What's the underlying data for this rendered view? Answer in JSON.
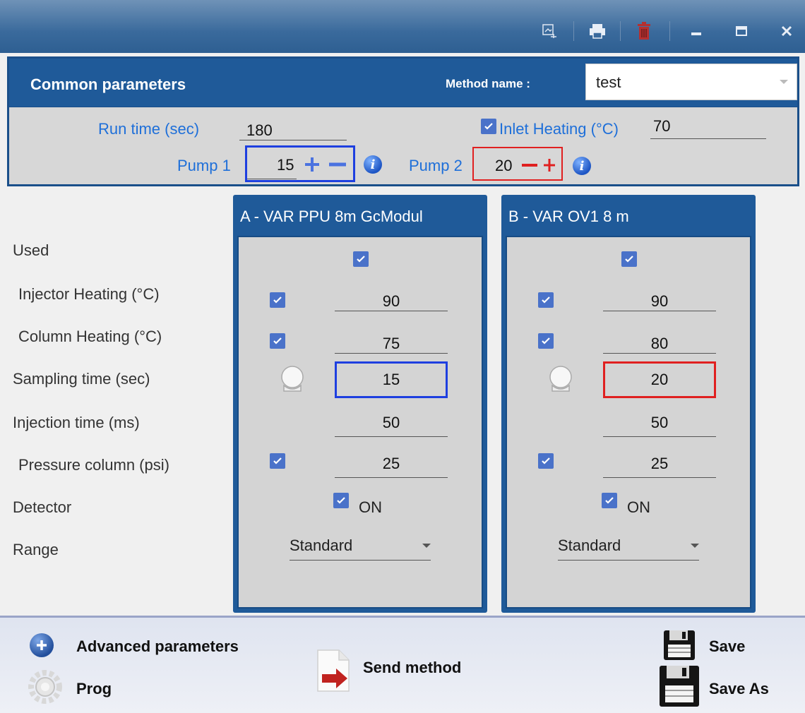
{
  "titlebar": {
    "icons": [
      "export-icon",
      "print-icon",
      "delete-icon",
      "minimize-icon",
      "maximize-icon",
      "close-icon"
    ]
  },
  "common": {
    "title": "Common parameters",
    "method_name_label": "Method name :",
    "method_name_value": "test",
    "run_time_label": "Run time (sec)",
    "run_time_value": "180",
    "inlet_heating_label": "Inlet Heating (°C)",
    "inlet_heating_value": "70",
    "pump1_label": "Pump 1",
    "pump1_value": "15",
    "pump2_label": "Pump 2",
    "pump2_value": "20",
    "pump1_color": "#1e3fe0",
    "pump2_color": "#e02020"
  },
  "rows": {
    "used": "Used",
    "injector_heating": "Injector Heating (°C)",
    "column_heating": "Column Heating (°C)",
    "sampling_time": "Sampling time (sec)",
    "injection_time": "Injection time (ms)",
    "pressure_column": "Pressure column (psi)",
    "detector": "Detector",
    "range": "Range"
  },
  "channels": [
    {
      "title": "A - VAR PPU 8m GcModul",
      "injector_heating": "90",
      "column_heating": "75",
      "sampling_time": "15",
      "injection_time": "50",
      "pressure_column": "25",
      "detector": "ON",
      "range": "Standard",
      "sampling_border": "#1e3fe0"
    },
    {
      "title": "B - VAR OV1 8 m",
      "injector_heating": "90",
      "column_heating": "80",
      "sampling_time": "20",
      "injection_time": "50",
      "pressure_column": "25",
      "detector": "ON",
      "range": "Standard",
      "sampling_border": "#e02020"
    }
  ],
  "bottom": {
    "advanced": "Advanced parameters",
    "prog": "Prog",
    "send_method": "Send method",
    "save": "Save",
    "save_as": "Save As"
  }
}
